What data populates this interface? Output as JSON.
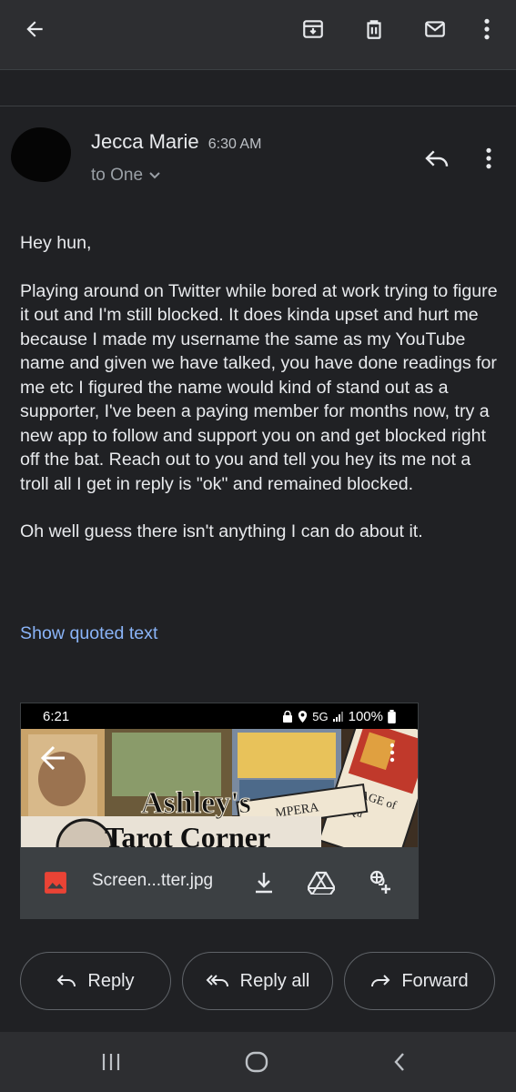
{
  "header": {
    "icons": [
      "back-arrow-icon",
      "archive-icon",
      "trash-icon",
      "mail-icon",
      "more-vert-icon"
    ]
  },
  "message": {
    "sender": "Jecca Marie",
    "time": "6:30 AM",
    "recipient": "to One",
    "body": [
      "Hey hun,",
      "Playing around on Twitter while bored at work trying to figure it out and I'm still blocked. It does kinda upset and hurt me because I made my username the same as my YouTube name and given we have talked, you have done readings for me etc I figured the name would kind of stand out as a supporter, I've been a paying member for months now, try a new app to follow and support you on and get blocked right off the bat. Reach out to you and tell you hey its me not a troll all I get in reply is \"ok\" and remained blocked.",
      "Oh well guess there isn't anything I can do about it."
    ],
    "quoted_link": "Show quoted text"
  },
  "attachment": {
    "filename": "Screen...tter.jpg",
    "thumbnail": {
      "status_time": "6:21",
      "status_network": "5G",
      "status_battery": "100%",
      "title_line1": "Ashley's",
      "title_line2": "Tarot Corner",
      "card_text_1": "MPERA",
      "card_text_2": "PAGE of",
      "card_text_3": "Qu"
    }
  },
  "actions": {
    "reply": "Reply",
    "reply_all": "Reply all",
    "forward": "Forward"
  },
  "colors": {
    "background": "#202124",
    "link": "#8ab4f8",
    "image_icon": "#ea4335"
  }
}
